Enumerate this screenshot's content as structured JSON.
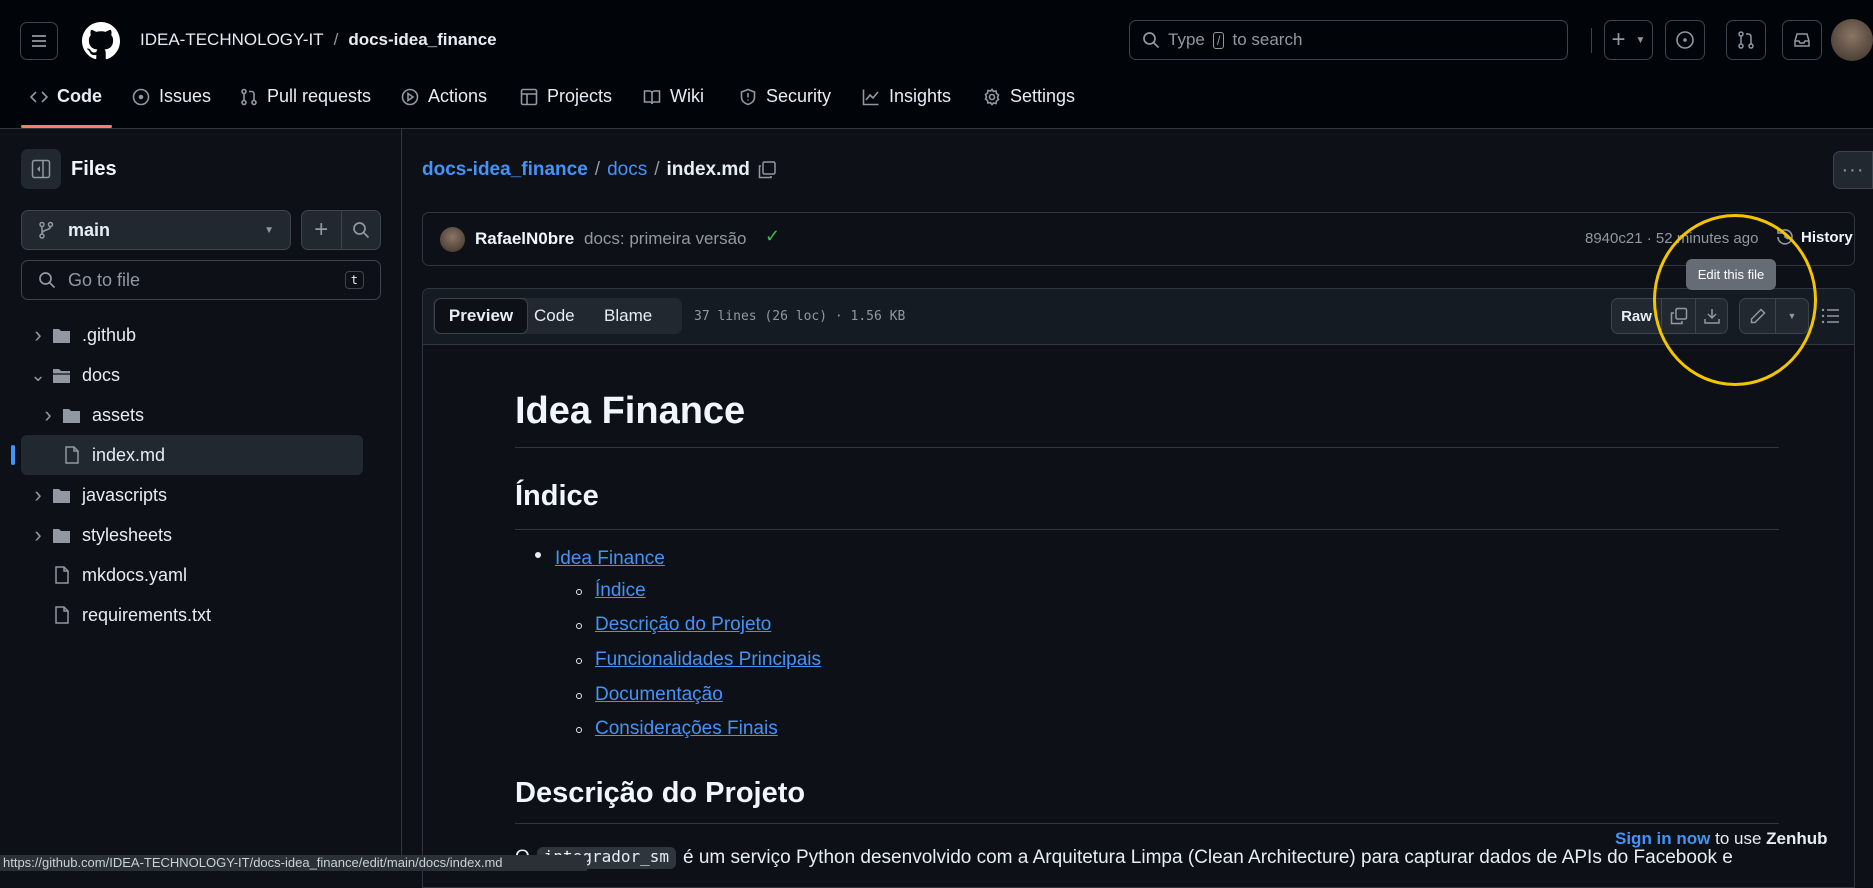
{
  "header": {
    "owner": "IDEA-TECHNOLOGY-IT",
    "separator": "/",
    "repo": "docs-idea_finance",
    "search_prefix": "Type",
    "search_key": "/",
    "search_suffix": "to search"
  },
  "nav": [
    {
      "label": "Code",
      "icon": "code-icon"
    },
    {
      "label": "Issues",
      "icon": "issue-icon"
    },
    {
      "label": "Pull requests",
      "icon": "pull-request-icon"
    },
    {
      "label": "Actions",
      "icon": "play-icon"
    },
    {
      "label": "Projects",
      "icon": "table-icon"
    },
    {
      "label": "Wiki",
      "icon": "book-icon"
    },
    {
      "label": "Security",
      "icon": "shield-icon"
    },
    {
      "label": "Insights",
      "icon": "graph-icon"
    },
    {
      "label": "Settings",
      "icon": "gear-icon"
    }
  ],
  "sidebar": {
    "title": "Files",
    "branch": "main",
    "go_to_file_placeholder": "Go to file",
    "shortcut": "t",
    "tree": [
      {
        "name": ".github",
        "type": "folder"
      },
      {
        "name": "docs",
        "type": "folder-open"
      },
      {
        "name": "assets",
        "type": "folder"
      },
      {
        "name": "index.md",
        "type": "file"
      },
      {
        "name": "javascripts",
        "type": "folder"
      },
      {
        "name": "stylesheets",
        "type": "folder"
      },
      {
        "name": "mkdocs.yaml",
        "type": "file"
      },
      {
        "name": "requirements.txt",
        "type": "file"
      }
    ]
  },
  "breadcrumb": {
    "repo": "docs-idea_finance",
    "sep": "/",
    "folder": "docs",
    "file": "index.md"
  },
  "commit": {
    "author": "RafaelN0bre",
    "message": "docs: primeira versão",
    "hash_time": "8940c21 · 52 minutes ago",
    "history": "History"
  },
  "file_toolbar": {
    "tabs": [
      "Preview",
      "Code",
      "Blame"
    ],
    "info": "37 lines (26 loc) · 1.56 KB",
    "raw": "Raw",
    "tooltip": "Edit this file"
  },
  "markdown": {
    "h1": "Idea Finance",
    "h2_index": "Índice",
    "toc": [
      "Idea Finance",
      "Índice",
      "Descrição do Projeto",
      "Funcionalidades Principais",
      "Documentação",
      "Considerações Finais"
    ],
    "h2_desc": "Descrição do Projeto",
    "para_start": "O",
    "para_code": "integrador_sm",
    "para_rest": "é um serviço Python desenvolvido com a Arquitetura Limpa (Clean Architecture) para capturar dados de APIs do Facebook e"
  },
  "zenhub": {
    "link": "Sign in now",
    "text": "to use",
    "brand": "Zenhub"
  },
  "status_url": "https://github.com/IDEA-TECHNOLOGY-IT/docs-idea_finance/edit/main/docs/index.md",
  "colors": {
    "accent": "#4493f8",
    "highlight": "#f5c400",
    "success": "#3fb950"
  }
}
